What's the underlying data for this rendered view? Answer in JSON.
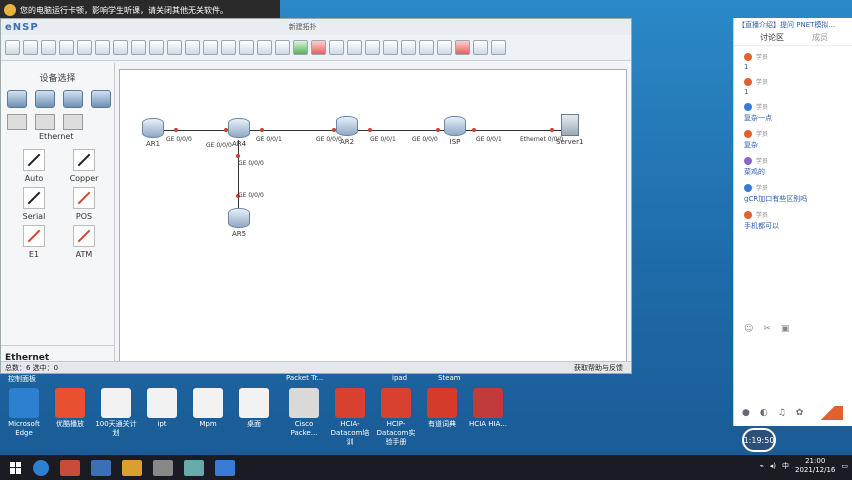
{
  "notice": {
    "text": "您的电脑运行卡顿，影响学生听课，请关闭其他无关软件。"
  },
  "ensp": {
    "logo": "eNSP",
    "caption": "新建拓扑",
    "panel_title": "设备选择",
    "ethernet_caption": "Ethernet",
    "cables": [
      {
        "label": "Auto",
        "color": "#222"
      },
      {
        "label": "Copper",
        "color": "#222"
      },
      {
        "label": "Serial",
        "color": "#222"
      },
      {
        "label": "POS",
        "color": "#d04a2a"
      },
      {
        "label": "E1",
        "color": "#d04a2a"
      },
      {
        "label": "ATM",
        "color": "#d04a2a"
      }
    ],
    "panel_footer": "Ethernet",
    "status_left": "总数：6  选中：0",
    "status_right": "获取帮助与反馈",
    "nodes": [
      {
        "name": "AR1",
        "type": "router"
      },
      {
        "name": "AR4",
        "type": "router"
      },
      {
        "name": "AR2",
        "type": "router"
      },
      {
        "name": "ISP",
        "type": "router"
      },
      {
        "name": "Server1",
        "type": "server"
      },
      {
        "name": "AR5",
        "type": "router"
      }
    ],
    "ports": [
      "GE 0/0/0",
      "GE 0/0/0",
      "GE 0/0/1",
      "GE 0/0/0",
      "GE 0/0/1",
      "GE 0/0/0",
      "GE 0/0/1",
      "Ethernet 0/0/0",
      "GE 0/0/0",
      "GE 0/0/0"
    ]
  },
  "desktop": {
    "labels_top": [
      "控制面板",
      "Packet Tr...",
      "ipad",
      "Steam"
    ],
    "icons": [
      {
        "label": "Microsoft Edge",
        "color": "#2d7fd0"
      },
      {
        "label": "优酷播放",
        "color": "#e85030"
      },
      {
        "label": "100天通关计划",
        "color": "#f2f2f2"
      },
      {
        "label": "ipt",
        "color": "#f2f2f2"
      },
      {
        "label": "Mpm",
        "color": "#f2f2f2"
      },
      {
        "label": "桌面",
        "color": "#f2f2f2"
      },
      {
        "label": "Cisco Packe...",
        "color": "#d9d9d9"
      },
      {
        "label": "HCIA-Datacom培训",
        "color": "#d8412f"
      },
      {
        "label": "HCIP-Datacom实验手册",
        "color": "#d8412f"
      },
      {
        "label": "有道词典",
        "color": "#d63a2a"
      },
      {
        "label": "HCIA HIA...",
        "color": "#c23a3a"
      }
    ]
  },
  "chat": {
    "top": "【直播介绍】提问  PNET模拟...",
    "tab_active": "讨论区",
    "tab_other": "成员",
    "messages": [
      {
        "who": "学员",
        "text": "1",
        "avatar": "#e06030"
      },
      {
        "who": "学员",
        "text": "1",
        "avatar": "#e06030"
      },
      {
        "who": "学员",
        "text": "复杂一点",
        "avatar": "#3a7bd5"
      },
      {
        "who": "学员",
        "text": "复杂",
        "avatar": "#e06030"
      },
      {
        "who": "学员",
        "text": "菜鸡的",
        "avatar": "#8a66c8"
      },
      {
        "who": "学员",
        "text": "gCR加口有些区别吗",
        "avatar": "#3a7bd5"
      },
      {
        "who": "学员",
        "text": "手机都可以",
        "avatar": "#e06030"
      }
    ]
  },
  "clock_badge": "1:19:50",
  "tray": {
    "time": "21:00",
    "date": "2021/12/16",
    "ime": "中"
  }
}
